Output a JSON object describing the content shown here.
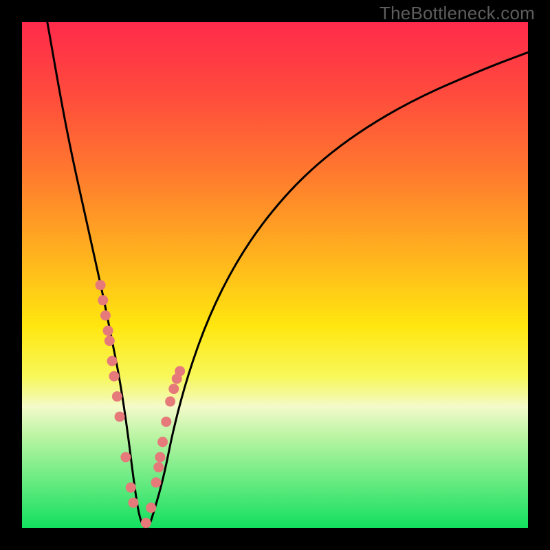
{
  "watermark": {
    "text": "TheBottleneck.com"
  },
  "colors": {
    "frame": "#000000",
    "gradient_stops": [
      {
        "pct": 0,
        "color": "#ff2a4b"
      },
      {
        "pct": 14,
        "color": "#ff4a3d"
      },
      {
        "pct": 30,
        "color": "#ff7a2e"
      },
      {
        "pct": 46,
        "color": "#ffb21e"
      },
      {
        "pct": 60,
        "color": "#ffe60f"
      },
      {
        "pct": 70,
        "color": "#f8f85a"
      },
      {
        "pct": 74,
        "color": "#f4f9a0"
      },
      {
        "pct": 76,
        "color": "#f4faca"
      },
      {
        "pct": 82,
        "color": "#b9f4a3"
      },
      {
        "pct": 100,
        "color": "#12e05e"
      }
    ],
    "curve_stroke": "#000000",
    "marker_fill": "#e67a7a"
  },
  "chart_data": {
    "type": "line",
    "title": "",
    "xlabel": "",
    "ylabel": "",
    "xlim": [
      0,
      100
    ],
    "ylim": [
      0,
      100
    ],
    "series": [
      {
        "name": "bottleneck-curve",
        "x": [
          5,
          8,
          10,
          12,
          14,
          16,
          17,
          18,
          19,
          20,
          21,
          22,
          23,
          24,
          25,
          26,
          28,
          30,
          33,
          37,
          42,
          48,
          56,
          66,
          78,
          92,
          100
        ],
        "y": [
          100,
          83,
          73,
          64,
          55,
          46,
          41,
          36,
          31,
          25,
          18,
          10,
          3,
          0,
          0,
          3,
          10,
          20,
          31,
          42,
          52,
          61,
          70,
          78,
          85,
          91,
          94
        ]
      }
    ],
    "markers": {
      "name": "highlight-points",
      "x": [
        15.5,
        16.0,
        16.5,
        17.0,
        17.3,
        17.8,
        18.2,
        18.8,
        19.3,
        20.5,
        21.5,
        22.0,
        24.5,
        25.5,
        26.5,
        27.0,
        27.3,
        27.8,
        28.5,
        29.3,
        30.0,
        30.6,
        31.2
      ],
      "y": [
        48,
        45,
        42,
        39,
        37,
        33,
        30,
        26,
        22,
        14,
        8,
        5,
        1,
        4,
        9,
        12,
        14,
        17,
        21,
        25,
        27.5,
        29.5,
        31
      ]
    }
  }
}
